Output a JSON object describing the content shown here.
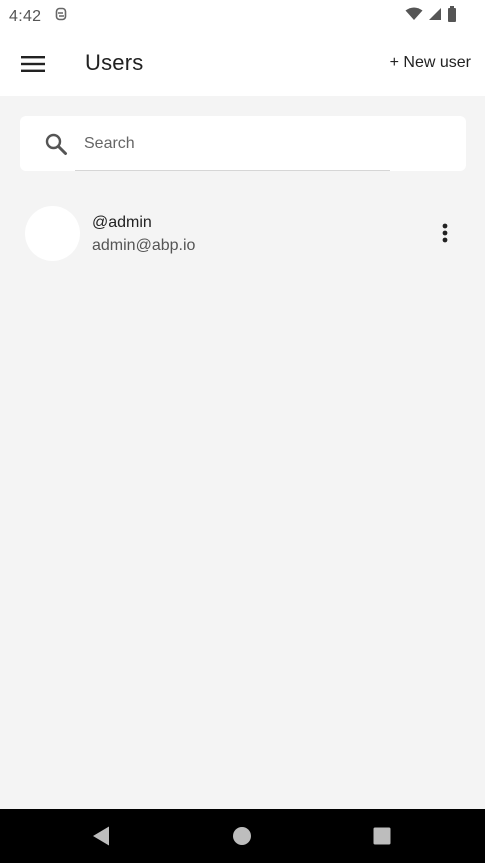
{
  "status_bar": {
    "time": "4:42",
    "icons": [
      "notification-icon",
      "wifi-icon",
      "cell-signal-icon",
      "battery-icon"
    ]
  },
  "app_bar": {
    "title": "Users",
    "new_user_label": "+ New user",
    "menu_icon": "hamburger-menu-icon"
  },
  "search": {
    "placeholder": "Search",
    "value": "",
    "icon": "search-icon"
  },
  "users": [
    {
      "username": "@admin",
      "email": "admin@abp.io"
    }
  ],
  "nav_bar": {
    "icons": [
      "back-icon",
      "home-icon",
      "recents-icon"
    ]
  },
  "colors": {
    "background": "#f4f4f4",
    "surface": "#ffffff",
    "nav_bar": "#000000",
    "text_primary": "#222222",
    "text_secondary": "#555555"
  }
}
